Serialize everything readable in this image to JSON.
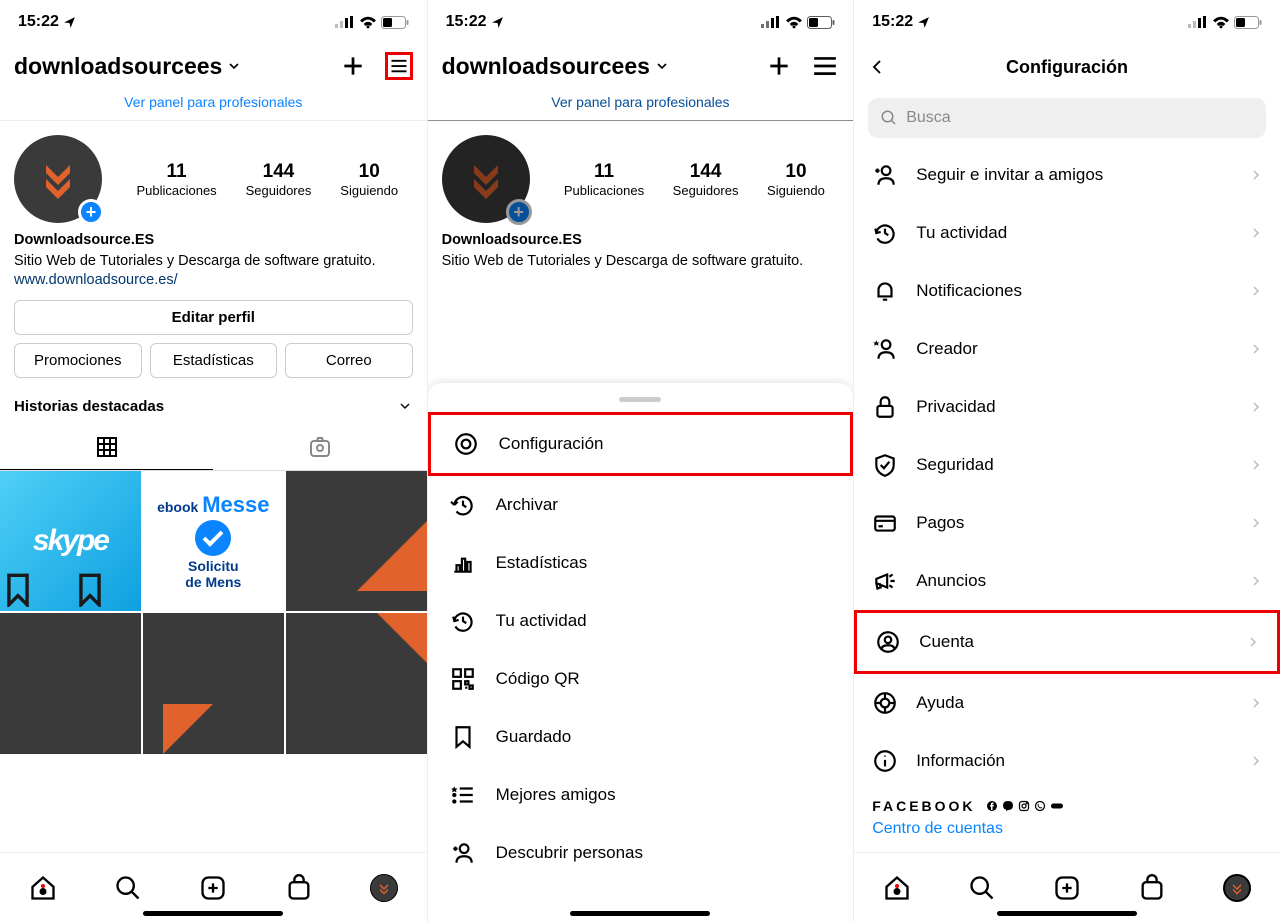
{
  "status": {
    "time": "15:22"
  },
  "panel1": {
    "username": "downloadsourcees",
    "pro_link": "Ver panel para profesionales",
    "stats": {
      "posts_n": "11",
      "posts_l": "Publicaciones",
      "followers_n": "144",
      "followers_l": "Seguidores",
      "following_n": "10",
      "following_l": "Siguiendo"
    },
    "bio": {
      "name": "Downloadsource.ES",
      "desc": "Sitio Web de Tutoriales y Descarga de software gratuito.",
      "url": "www.downloadsource.es/"
    },
    "btn_edit": "Editar perfil",
    "btn_promo": "Promociones",
    "btn_stats": "Estadísticas",
    "btn_mail": "Correo",
    "stories": "Historias destacadas",
    "skype_text": "skype",
    "msg_l1": "ebook",
    "msg_l2": "Messe",
    "msg_l3": "Solicitu",
    "msg_l4": "de Mens"
  },
  "panel2": {
    "username": "downloadsourcees",
    "pro_link": "Ver panel para profesionales",
    "stats": {
      "posts_n": "11",
      "posts_l": "Publicaciones",
      "followers_n": "144",
      "followers_l": "Seguidores",
      "following_n": "10",
      "following_l": "Siguiendo"
    },
    "bio": {
      "name": "Downloadsource.ES",
      "desc": "Sitio Web de Tutoriales y Descarga de software gratuito."
    },
    "menu": {
      "config": "Configuración",
      "archive": "Archivar",
      "stats": "Estadísticas",
      "activity": "Tu actividad",
      "qr": "Código QR",
      "saved": "Guardado",
      "friends": "Mejores amigos",
      "discover": "Descubrir personas"
    }
  },
  "panel3": {
    "title": "Configuración",
    "search_ph": "Busca",
    "items": {
      "follow": "Seguir e invitar a amigos",
      "activity": "Tu actividad",
      "notif": "Notificaciones",
      "creator": "Creador",
      "privacy": "Privacidad",
      "security": "Seguridad",
      "payments": "Pagos",
      "ads": "Anuncios",
      "account": "Cuenta",
      "help": "Ayuda",
      "info": "Información"
    },
    "fb_label": "FACEBOOK",
    "center": "Centro de cuentas"
  }
}
